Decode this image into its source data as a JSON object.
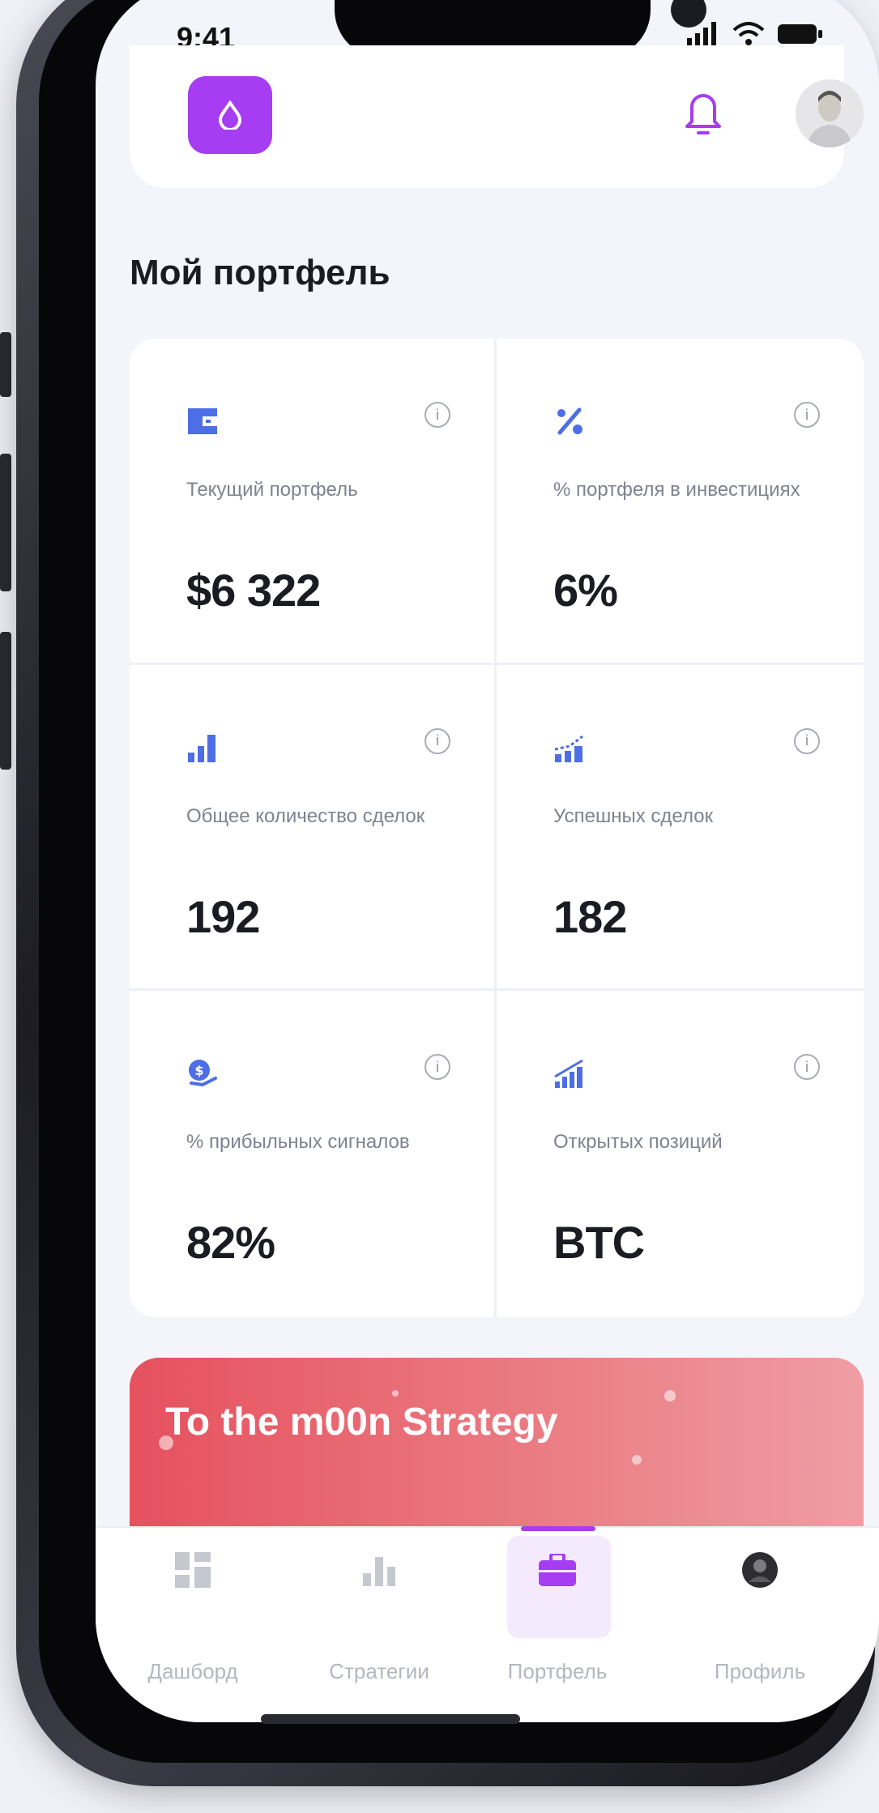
{
  "status_bar": {
    "time": "9:41"
  },
  "header": {
    "logo_icon": "drop-icon",
    "notification_icon": "bell-icon",
    "avatar_icon": "user-avatar"
  },
  "page": {
    "title": "Мой портфель"
  },
  "stats": [
    {
      "icon": "wallet-icon",
      "label": "Текущий портфель",
      "value": "$6 322"
    },
    {
      "icon": "percent-icon",
      "label": "% портфеля в инвестициях",
      "value": "6%"
    },
    {
      "icon": "bar-chart-icon",
      "label": "Общее количество сделок",
      "value": "192"
    },
    {
      "icon": "trend-bars-icon",
      "label": "Успешных сделок",
      "value": "182"
    },
    {
      "icon": "profit-signal-icon",
      "label": "% прибыльных сигналов",
      "value": "82%"
    },
    {
      "icon": "growth-bars-icon",
      "label": "Открытых позиций",
      "value": "BTC"
    }
  ],
  "promo": {
    "title": "To the m00n Strategy"
  },
  "tabbar": {
    "items": [
      {
        "label": "Дашборд",
        "icon": "dashboard-icon",
        "active": false
      },
      {
        "label": "Стратегии",
        "icon": "strategies-icon",
        "active": false
      },
      {
        "label": "Портфель",
        "icon": "briefcase-icon",
        "active": true
      },
      {
        "label": "Профиль",
        "icon": "profile-icon",
        "active": false
      }
    ]
  },
  "colors": {
    "accent": "#a63df2",
    "icon_blue": "#4d6ee6",
    "promo_red": "#e6515e"
  }
}
